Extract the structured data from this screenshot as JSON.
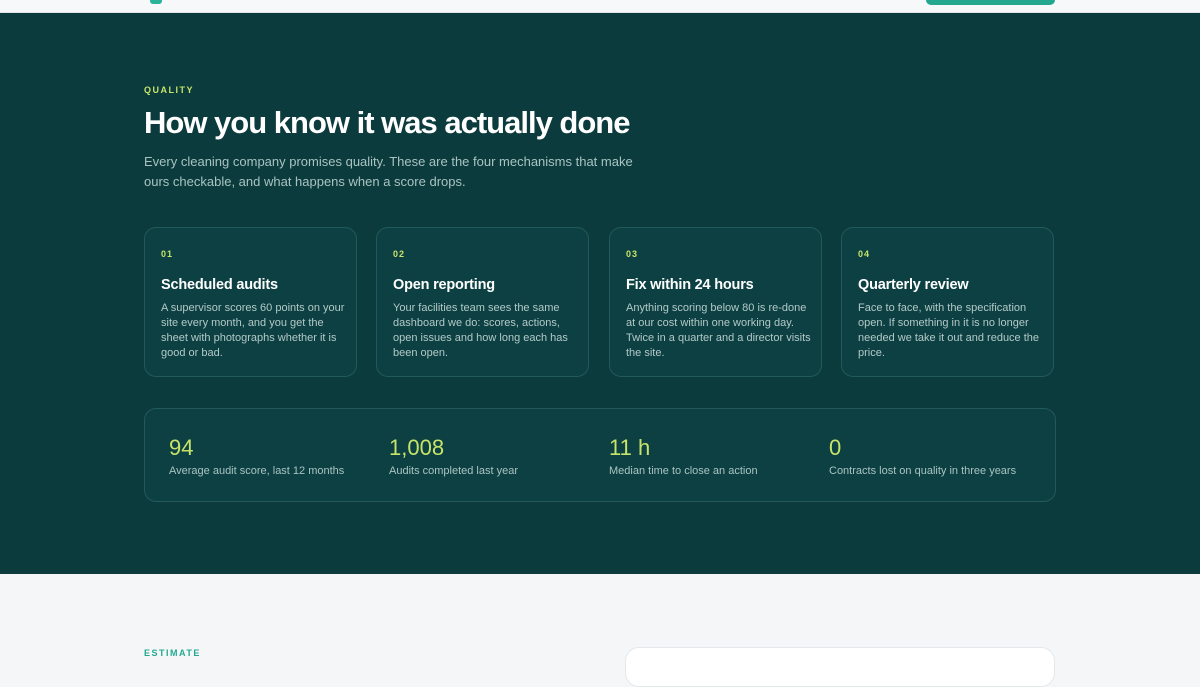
{
  "quality": {
    "eyebrow": "QUALITY",
    "title": "How you know it was actually done",
    "subtitle": "Every cleaning company promises quality. These are the four mechanisms that make ours checkable, and what happens when a score drops.",
    "cards": [
      {
        "num": "01",
        "title": "Scheduled audits",
        "desc": "A supervisor scores 60 points on your site every month, and you get the sheet with photographs whether it is good or bad."
      },
      {
        "num": "02",
        "title": "Open reporting",
        "desc": "Your facilities team sees the same dashboard we do: scores, actions, open issues and how long each has been open."
      },
      {
        "num": "03",
        "title": "Fix within 24 hours",
        "desc": "Anything scoring below 80 is re-done at our cost within one working day. Twice in a quarter and a director visits the site."
      },
      {
        "num": "04",
        "title": "Quarterly review",
        "desc": "Face to face, with the specification open. If something in it is no longer needed we take it out and reduce the price."
      }
    ],
    "stats": [
      {
        "value": "94",
        "label": "Average audit score, last 12 months"
      },
      {
        "value": "1,008",
        "label": "Audits completed last year"
      },
      {
        "value": "11 h",
        "label": "Median time to close an action"
      },
      {
        "value": "0",
        "label": "Contracts lost on quality in three years"
      }
    ]
  },
  "estimate": {
    "eyebrow": "ESTIMATE"
  },
  "colors": {
    "section_bg": "#0b3b3d",
    "accent": "#c6e36a",
    "teal": "#23a88f"
  }
}
